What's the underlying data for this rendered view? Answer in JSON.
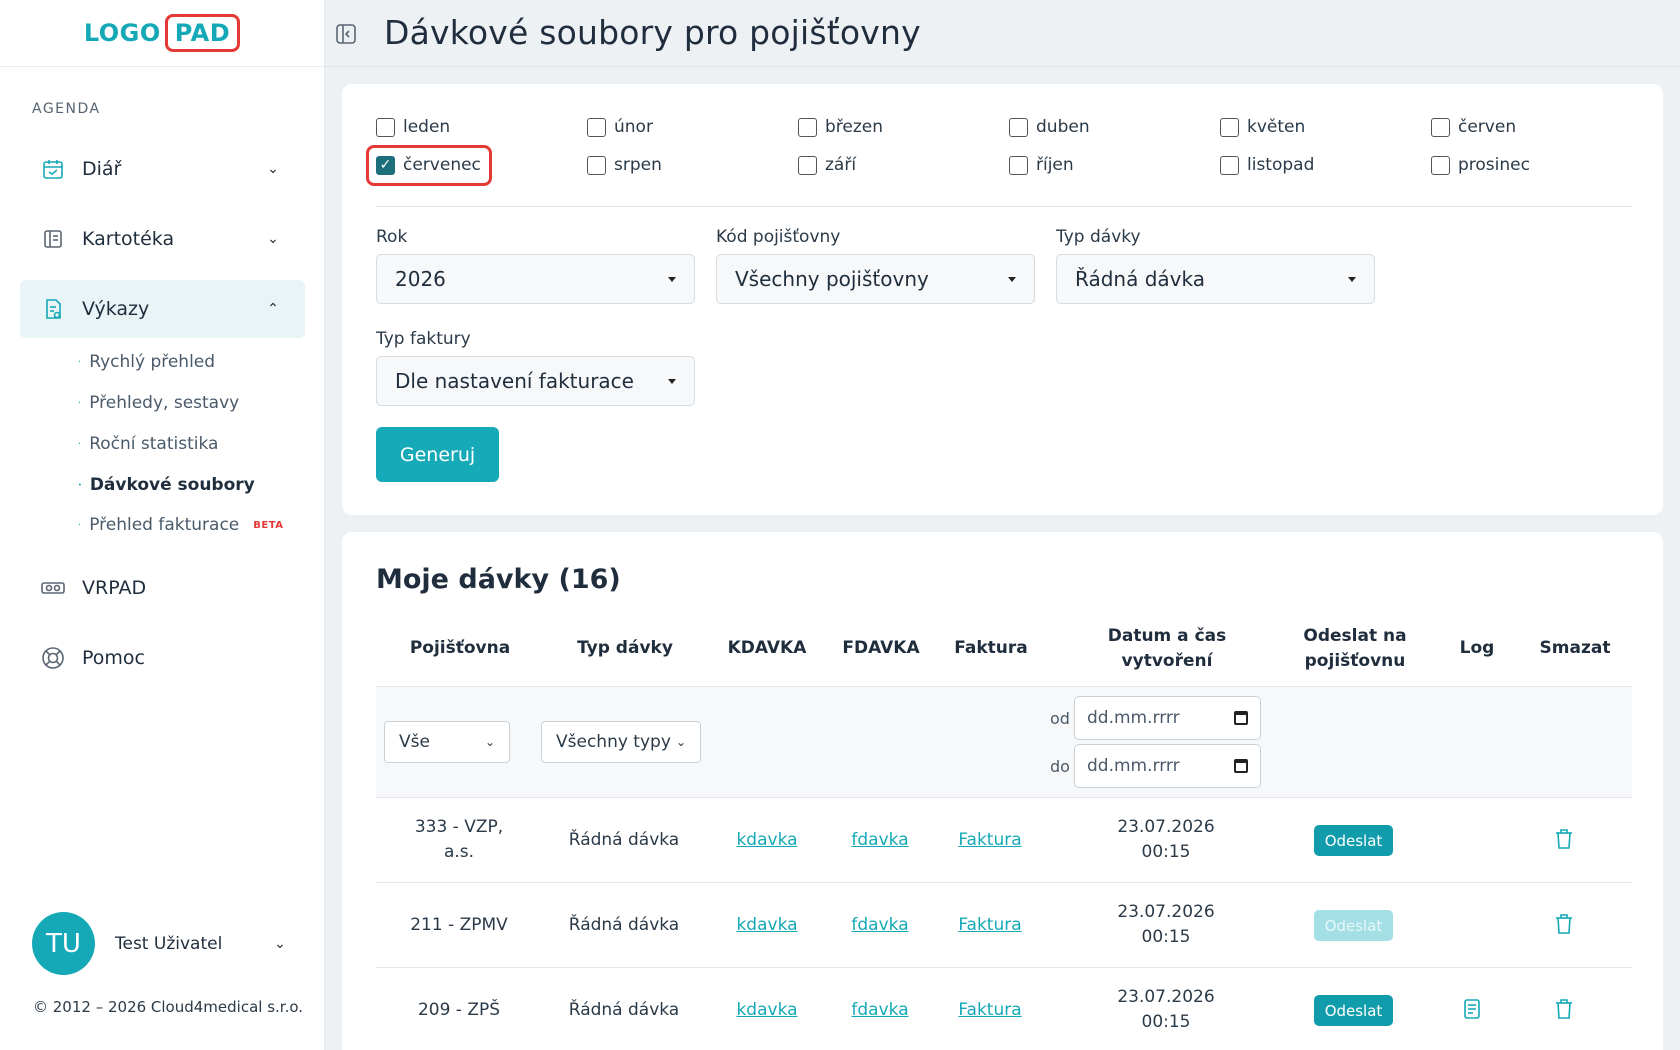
{
  "brand": {
    "logo_left": "LOGO",
    "logo_right": "PAD"
  },
  "sidebar": {
    "section": "AGENDA",
    "items": [
      {
        "label": "Diář",
        "icon": "calendar-icon"
      },
      {
        "label": "Kartotéka",
        "icon": "card-index-icon"
      },
      {
        "label": "Výkazy",
        "icon": "report-icon"
      },
      {
        "label": "VRPAD",
        "icon": "vr-glasses-icon"
      },
      {
        "label": "Pomoc",
        "icon": "lifebuoy-icon"
      }
    ],
    "subitems": [
      "Rychlý přehled",
      "Přehledy, sestavy",
      "Roční statistika",
      "Dávkové soubory",
      "Přehled fakturace"
    ],
    "beta_label": "BETA",
    "user": {
      "initials": "TU",
      "name": "Test Uživatel"
    },
    "copyright": "© 2012 – 2026 Cloud4medical s.r.o."
  },
  "header": {
    "title": "Dávkové soubory pro pojišťovny"
  },
  "months": [
    {
      "label": "leden",
      "checked": false
    },
    {
      "label": "únor",
      "checked": false
    },
    {
      "label": "březen",
      "checked": false
    },
    {
      "label": "duben",
      "checked": false
    },
    {
      "label": "květen",
      "checked": false
    },
    {
      "label": "červen",
      "checked": false
    },
    {
      "label": "červenec",
      "checked": true
    },
    {
      "label": "srpen",
      "checked": false
    },
    {
      "label": "září",
      "checked": false
    },
    {
      "label": "říjen",
      "checked": false
    },
    {
      "label": "listopad",
      "checked": false
    },
    {
      "label": "prosinec",
      "checked": false
    }
  ],
  "form": {
    "rok": {
      "label": "Rok",
      "value": "2026"
    },
    "kod": {
      "label": "Kód pojišťovny",
      "value": "Všechny pojišťovny"
    },
    "typ_davky": {
      "label": "Typ dávky",
      "value": "Řádná dávka"
    },
    "typ_faktury": {
      "label": "Typ faktury",
      "value": "Dle nastavení fakturace"
    },
    "generate_label": "Generuj"
  },
  "list": {
    "title": "Moje dávky (16)",
    "headers": [
      "Pojišťovna",
      "Typ dávky",
      "KDAVKA",
      "FDAVKA",
      "Faktura",
      "Datum a čas vytvoření",
      "Odeslat na pojišťovnu",
      "Log",
      "Smazat"
    ],
    "filters": {
      "insurer": "Vše",
      "type": "Všechny typy",
      "from_label": "od",
      "to_label": "do",
      "date_placeholder": "dd.mm.rrrr"
    },
    "rows": [
      {
        "insurer": "333 - VZP, a.s.",
        "type": "Řádná dávka",
        "kdavka": "kdavka",
        "fdavka": "fdavka",
        "faktura": "Faktura",
        "date": "23.07.2026",
        "time": "00:15",
        "send": "Odeslat",
        "send_enabled": true,
        "has_log": false
      },
      {
        "insurer": "211 - ZPMV",
        "type": "Řádná dávka",
        "kdavka": "kdavka",
        "fdavka": "fdavka",
        "faktura": "Faktura",
        "date": "23.07.2026",
        "time": "00:15",
        "send": "Odeslat",
        "send_enabled": false,
        "has_log": false
      },
      {
        "insurer": "209 - ZPŠ",
        "type": "Řádná dávka",
        "kdavka": "kdavka",
        "fdavka": "fdavka",
        "faktura": "Faktura",
        "date": "23.07.2026",
        "time": "00:15",
        "send": "Odeslat",
        "send_enabled": true,
        "has_log": true
      }
    ]
  },
  "colors": {
    "accent": "#15a9b7",
    "highlight": "#e53935",
    "checked": "#1c6f7a"
  }
}
